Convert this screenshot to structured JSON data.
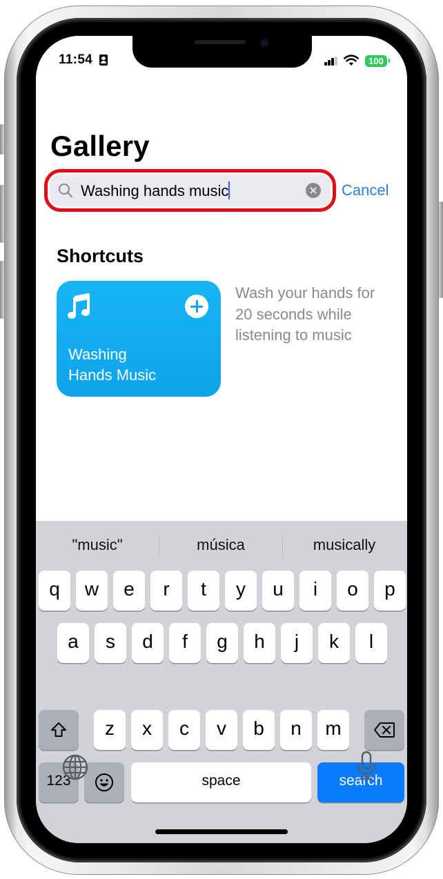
{
  "status_bar": {
    "time": "11:54",
    "battery": "100",
    "icons": [
      "contact-card-icon",
      "cellular-signal-icon",
      "wifi-icon",
      "battery-icon"
    ]
  },
  "page": {
    "title": "Gallery"
  },
  "search": {
    "value": "Washing hands music",
    "cancel_label": "Cancel",
    "highlight_color": "#e20d17"
  },
  "section": {
    "title": "Shortcuts"
  },
  "shortcut": {
    "icon": "music-note-icon",
    "title_line1": "Washing",
    "title_line2": "Hands Music",
    "description": "Wash your hands for 20 seconds while listening to music",
    "color": "#0ea3ec"
  },
  "keyboard": {
    "suggestions": [
      "\"music\"",
      "música",
      "musically"
    ],
    "row1": [
      "q",
      "w",
      "e",
      "r",
      "t",
      "y",
      "u",
      "i",
      "o",
      "p"
    ],
    "row2": [
      "a",
      "s",
      "d",
      "f",
      "g",
      "h",
      "j",
      "k",
      "l"
    ],
    "row3": [
      "z",
      "x",
      "c",
      "v",
      "b",
      "n",
      "m"
    ],
    "numbers_label": "123",
    "space_label": "space",
    "search_label": "search",
    "accent_color": "#0a7aff"
  }
}
